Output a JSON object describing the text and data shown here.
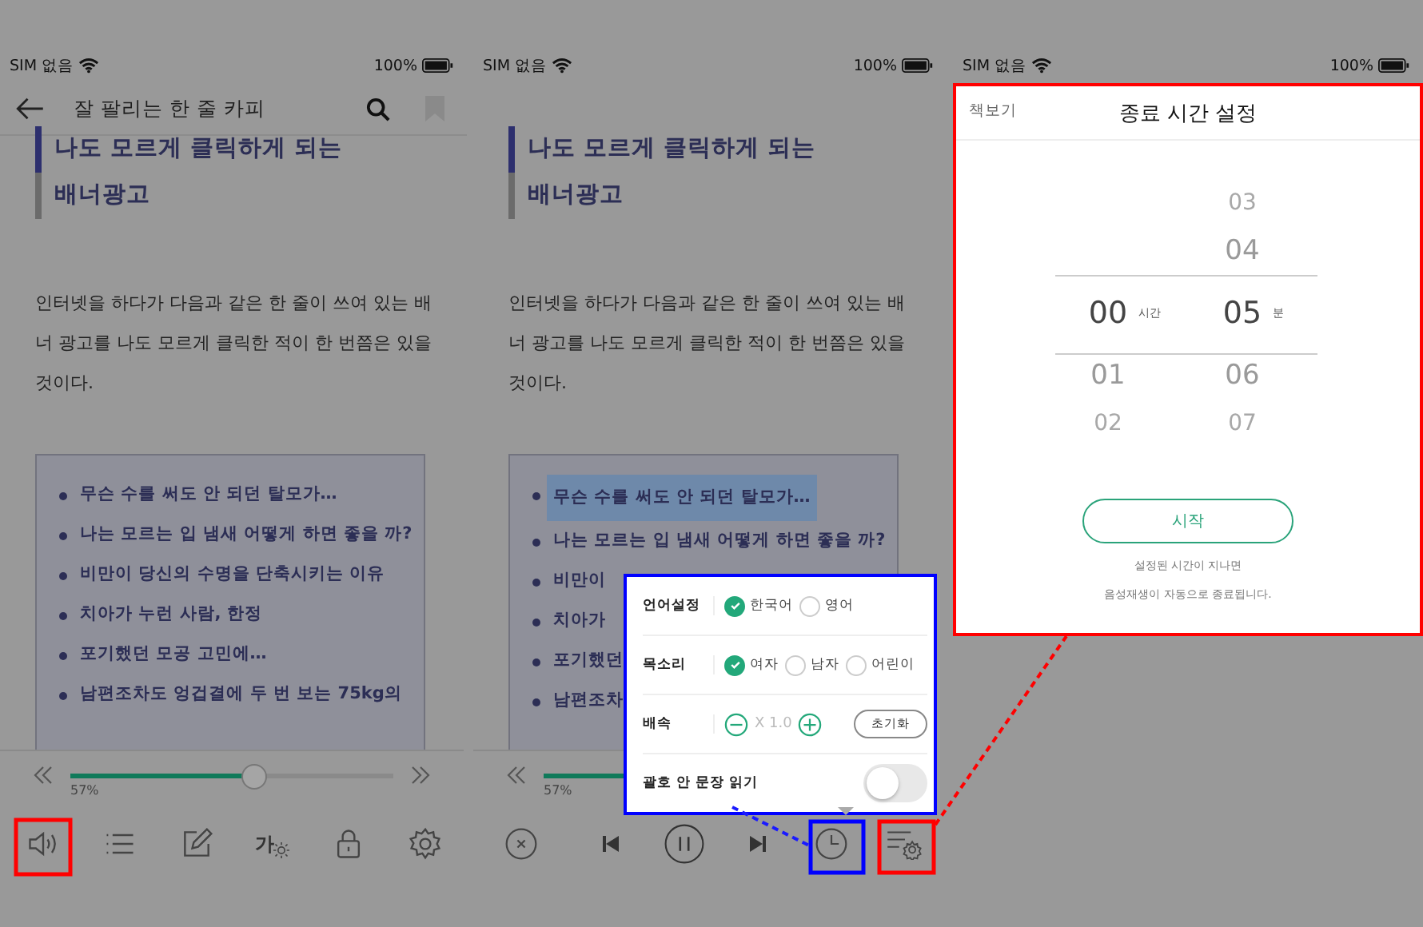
{
  "screens": [
    {
      "kind": "reader",
      "status": {
        "carrier": "SIM 없음",
        "battery": "100%"
      },
      "header": {
        "title": "잘 팔리는 한 줄 카피"
      },
      "heading": [
        "나도 모르게 클릭하게 되는",
        "배너광고"
      ],
      "paragraph": "인터넷을 하다가 다음과 같은 한 줄이 쓰여 있는 배너 광고를 나도 모르게 클릭한 적이 한 번쯤은 있을 것이다.",
      "list": [
        {
          "text": "무슨 수를 써도 안 되던 탈모가…",
          "selected": false
        },
        {
          "text": "나는 모르는 입 냄새 어떻게 하면 좋을 까?",
          "selected": false
        },
        {
          "text": "비만이 당신의 수명을 단축시키는 이유",
          "selected": false
        },
        {
          "text": "치아가 누런 사람, 한정",
          "selected": false
        },
        {
          "text": "포기했던 모공 고민에…",
          "selected": false
        },
        {
          "text": "남편조차도 엉겁결에 두 번 보는 75kg의",
          "selected": false
        }
      ],
      "progress": {
        "level": 0.57,
        "reading": "57%"
      },
      "toolbar": [
        {
          "kind": "speaker"
        },
        {
          "kind": "contents"
        },
        {
          "kind": "pencil"
        },
        {
          "kind": "font",
          "label": "가"
        },
        {
          "kind": "lock"
        },
        {
          "kind": "gear"
        }
      ]
    },
    {
      "kind": "player",
      "status": {
        "carrier": "SIM 없음",
        "battery": "100%"
      },
      "heading": [
        "나도 모르게 클릭하게 되는",
        "배너광고"
      ],
      "paragraph": "인터넷을 하다가 다음과 같은 한 줄이 쓰여 있는 배너 광고를 나도 모르게 클릭한 적이 한 번쯤은 있을 것이다.",
      "list": [
        {
          "text": "무슨 수를 써도 안 되던 탈모가…",
          "selected": true
        },
        {
          "text": "나는 모르는 입 냄새 어떻게 하면 좋을 까?",
          "selected": false
        },
        {
          "text": "비만이",
          "selected": false
        },
        {
          "text": "치아가",
          "selected": false
        },
        {
          "text": "포기했던",
          "selected": false
        },
        {
          "text": "남편조차",
          "selected": false
        }
      ],
      "progress": {
        "level": 0.57,
        "reading": "57%"
      },
      "toolbar": [
        {
          "kind": "close"
        },
        {
          "kind": "prev"
        },
        {
          "kind": "pause"
        },
        {
          "kind": "next"
        },
        {
          "kind": "timer"
        },
        {
          "kind": "voice-settings"
        }
      ],
      "popup": {
        "rows": [
          {
            "kind": "radio",
            "label": "언어설정",
            "options": [
              {
                "label": "한국어",
                "selected": true
              },
              {
                "label": "영어",
                "selected": false
              }
            ]
          },
          {
            "kind": "radio",
            "label": "목소리",
            "options": [
              {
                "label": "여자",
                "selected": true
              },
              {
                "label": "남자",
                "selected": false
              },
              {
                "label": "어린이",
                "selected": false
              }
            ]
          },
          {
            "kind": "stepper",
            "label": "배속",
            "value": "X 1.0",
            "reset": "초기화"
          },
          {
            "kind": "toggle",
            "label": "괄호 안 문장 읽기",
            "on": false
          }
        ]
      }
    },
    {
      "kind": "timer",
      "status": {
        "carrier": "SIM 없음",
        "battery": "100%"
      },
      "panel": {
        "back": "책보기",
        "title": "종료 시간 설정",
        "hours": {
          "unit": "시간",
          "items": [
            {
              "value": "00",
              "selected": true
            },
            {
              "value": "01",
              "selected": false
            },
            {
              "value": "02",
              "selected": false
            }
          ]
        },
        "minutes": {
          "unit": "분",
          "items": [
            {
              "value": "03",
              "selected": false
            },
            {
              "value": "04",
              "selected": false
            },
            {
              "value": "05",
              "selected": true
            },
            {
              "value": "06",
              "selected": false
            },
            {
              "value": "07",
              "selected": false
            }
          ]
        },
        "start": "시작",
        "note": [
          "설정된 시간이 지나면",
          "음성재생이 자동으로 종료됩니다."
        ]
      }
    }
  ]
}
